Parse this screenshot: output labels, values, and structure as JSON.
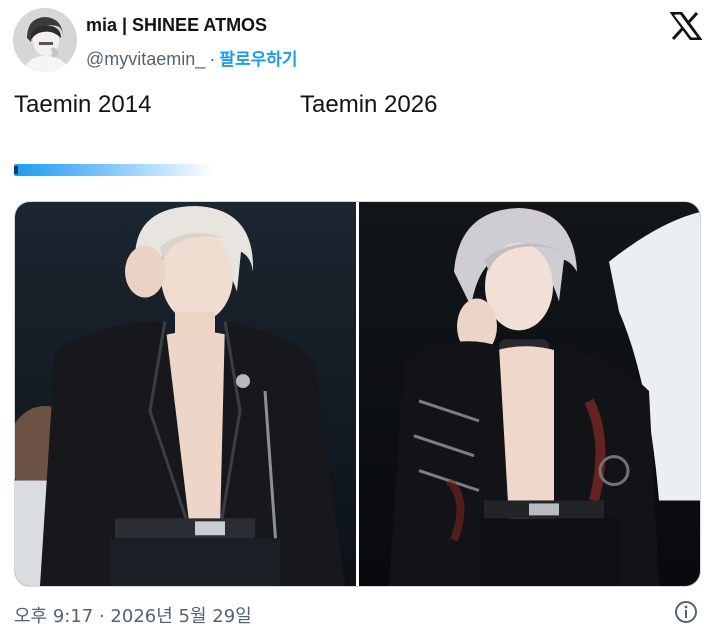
{
  "author": {
    "display_name": "mia | SHINEE ATMOS",
    "handle": "@myvitaemin_",
    "separator": "·",
    "follow_label": "팔로우하기"
  },
  "tweet": {
    "text_left": "Taemin 2014",
    "text_right": "Taemin 2026"
  },
  "timestamp": "오후 9:17 · 2026년 5월 29일",
  "icons": {
    "logo": "x-logo-icon",
    "info": "info-icon"
  },
  "colors": {
    "accent": "#1d9bf0",
    "text": "#0f1419",
    "muted": "#536471",
    "border": "#cfd9de"
  }
}
